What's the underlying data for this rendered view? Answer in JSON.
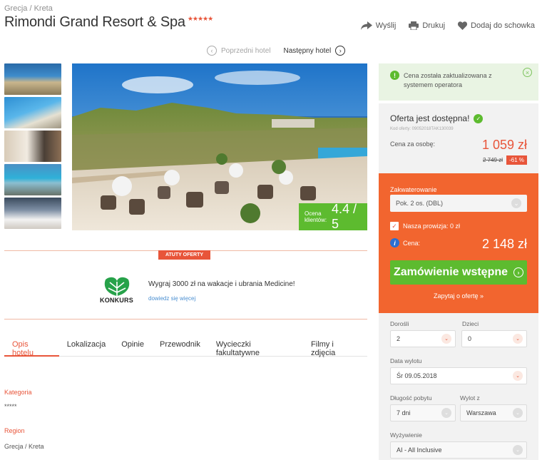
{
  "breadcrumb": "Grecja /  Kreta",
  "hotel": {
    "name": "Rimondi Grand Resort & Spa",
    "stars": "★★★★★"
  },
  "toolbar": {
    "send": "Wyślij",
    "print": "Drukuj",
    "save": "Dodaj do schowka"
  },
  "hotel_nav": {
    "prev": "Poprzedni hotel",
    "next": "Następny hotel"
  },
  "rating": {
    "label": "Ocena klientów:",
    "value": "4.4 / 5"
  },
  "promo": {
    "badge": "ATUTY OFERTY",
    "logo_text": "KONKURS",
    "text": "Wygraj 3000 zł na wakacje i ubrania Medicine!",
    "link": "dowiedz się więcej"
  },
  "tabs": [
    "Opis hotelu",
    "Lokalizacja",
    "Opinie",
    "Przewodnik",
    "Wycieczki fakultatywne",
    "Filmy i zdjęcia"
  ],
  "info": {
    "category_label": "Kategoria",
    "category_value": "*****",
    "region_label": "Region",
    "region_value": "Grecja / Kreta"
  },
  "notice": "Cena została zaktualizowana z systemem operatora",
  "offer": {
    "available": "Oferta jest dostępna!",
    "code": "Kod oferty: 09052018TAK130039",
    "per_person_label": "Cena za osobę:",
    "price": "1 059 zł",
    "old_price": "2 749 zł",
    "discount": "-61 %"
  },
  "booking": {
    "accommodation_label": "Zakwaterowanie",
    "accommodation_value": "Pok. 2 os. (DBL)",
    "commission": "Nasza prowizja: 0 zł",
    "price_label": "Cena:",
    "total": "2 148 zł",
    "order_button": "Zamówienie wstępne",
    "ask": "Zapytaj o ofertę »"
  },
  "filters": {
    "adults_label": "Dorośli",
    "adults_value": "2",
    "children_label": "Dzieci",
    "children_value": "0",
    "departure_label": "Data wylotu",
    "departure_value": "Śr 09.05.2018",
    "duration_label": "Długość pobytu",
    "duration_value": "7 dni",
    "from_label": "Wylot z",
    "from_value": "Warszawa",
    "board_label": "Wyżywienie",
    "board_value": "AI - All Inclusive"
  },
  "colors": {
    "accent": "#e8553a",
    "orange_panel": "#f2652f",
    "green": "#5dbb2f"
  }
}
